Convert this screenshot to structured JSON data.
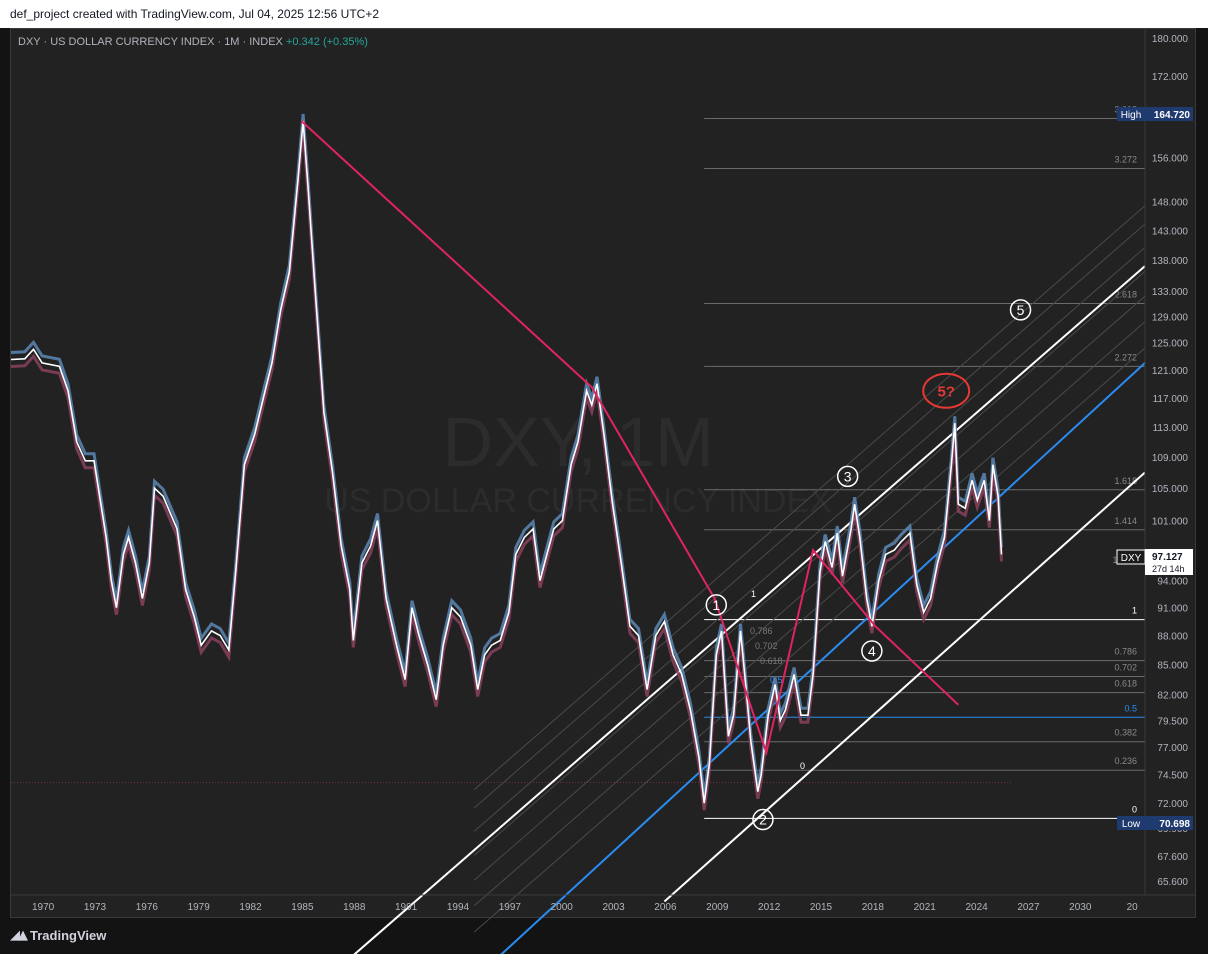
{
  "header": {
    "caption": "def_project created with TradingView.com, Jul 04, 2025 12:56 UTC+2"
  },
  "legend": {
    "symbol_text": "DXY · US DOLLAR CURRENCY INDEX · 1M · INDEX",
    "change_text": "+0.342 (+0.35%)"
  },
  "watermark": {
    "line1": "DXY, 1M",
    "line2": "US DOLLAR CURRENCY INDEX"
  },
  "footer": {
    "brand": "TradingView",
    "logo_icon": "tradingview-logo-icon"
  },
  "colors": {
    "background": "#222222",
    "price_line": "#ffffff",
    "upper_band": "#5b87b5",
    "lower_band": "#8a3f5e",
    "trendline": "#e0245e",
    "channel": "#ffffff",
    "midline": "#2a8cf0",
    "wave5_marker": "#e53935",
    "change_text": "#26a69a"
  },
  "chart_data": {
    "type": "line",
    "title": "DXY · US DOLLAR CURRENCY INDEX · 1M · INDEX",
    "scale": "log",
    "ylim": [
      64.5,
      182
    ],
    "xlim": [
      1968.2,
      2033.8
    ],
    "x_ticks": [
      "1970",
      "1973",
      "1976",
      "1979",
      "1982",
      "1985",
      "1988",
      "1991",
      "1994",
      "1997",
      "2000",
      "2003",
      "2006",
      "2009",
      "2012",
      "2015",
      "2018",
      "2021",
      "2024",
      "2027",
      "2030",
      "20"
    ],
    "y_ticks": [
      "180.000",
      "172.000",
      "156.000",
      "148.000",
      "143.000",
      "138.000",
      "133.000",
      "129.000",
      "125.000",
      "121.000",
      "117.000",
      "113.000",
      "109.000",
      "105.000",
      "101.000",
      "94.000",
      "91.000",
      "88.000",
      "85.000",
      "82.000",
      "79.500",
      "77.000",
      "74.500",
      "72.000",
      "69.900",
      "67.600",
      "65.600"
    ],
    "series": [
      {
        "values": [
          [
            1968.2,
            122.5
          ],
          [
            1969.0,
            122.6
          ],
          [
            1969.5,
            124.0
          ],
          [
            1970.0,
            122.0
          ],
          [
            1971.0,
            121.5
          ],
          [
            1971.5,
            118.0
          ],
          [
            1972.0,
            111.0
          ],
          [
            1972.5,
            108.5
          ],
          [
            1973.0,
            108.5
          ],
          [
            1973.4,
            103.0
          ],
          [
            1973.7,
            99.0
          ],
          [
            1974.0,
            94.0
          ],
          [
            1974.3,
            91.0
          ],
          [
            1974.7,
            97.0
          ],
          [
            1975.0,
            99.0
          ],
          [
            1975.4,
            96.0
          ],
          [
            1975.8,
            92.0
          ],
          [
            1976.2,
            96.0
          ],
          [
            1976.5,
            105.0
          ],
          [
            1977.0,
            104.0
          ],
          [
            1977.8,
            100.0
          ],
          [
            1978.3,
            93.0
          ],
          [
            1978.8,
            90.0
          ],
          [
            1979.2,
            87.0
          ],
          [
            1979.8,
            88.5
          ],
          [
            1980.3,
            88.0
          ],
          [
            1980.8,
            86.5
          ],
          [
            1981.2,
            95.0
          ],
          [
            1981.7,
            108.0
          ],
          [
            1982.3,
            112.0
          ],
          [
            1982.8,
            117.0
          ],
          [
            1983.3,
            122.0
          ],
          [
            1983.8,
            130.0
          ],
          [
            1984.3,
            136.0
          ],
          [
            1984.8,
            152.0
          ],
          [
            1985.1,
            163.0
          ],
          [
            1985.4,
            150.0
          ],
          [
            1985.8,
            133.0
          ],
          [
            1986.3,
            115.0
          ],
          [
            1986.8,
            107.0
          ],
          [
            1987.3,
            98.0
          ],
          [
            1987.8,
            93.0
          ],
          [
            1988.0,
            87.5
          ],
          [
            1988.5,
            96.0
          ],
          [
            1989.0,
            98.0
          ],
          [
            1989.4,
            101.0
          ],
          [
            1989.9,
            92.0
          ],
          [
            1990.5,
            87.0
          ],
          [
            1991.0,
            83.5
          ],
          [
            1991.4,
            91.0
          ],
          [
            1991.8,
            88.0
          ],
          [
            1992.3,
            85.0
          ],
          [
            1992.8,
            81.5
          ],
          [
            1993.2,
            87.0
          ],
          [
            1993.7,
            91.0
          ],
          [
            1994.2,
            90.0
          ],
          [
            1994.8,
            87.0
          ],
          [
            1995.2,
            82.5
          ],
          [
            1995.6,
            86.0
          ],
          [
            1996.0,
            87.0
          ],
          [
            1996.5,
            87.5
          ],
          [
            1997.0,
            90.5
          ],
          [
            1997.4,
            97.0
          ],
          [
            1997.9,
            99.0
          ],
          [
            1998.4,
            100.0
          ],
          [
            1998.8,
            94.0
          ],
          [
            1999.2,
            97.0
          ],
          [
            1999.6,
            100.0
          ],
          [
            2000.1,
            101.0
          ],
          [
            2000.6,
            108.0
          ],
          [
            2001.0,
            111.0
          ],
          [
            2001.5,
            118.0
          ],
          [
            2001.8,
            116.0
          ],
          [
            2002.1,
            119.0
          ],
          [
            2002.5,
            112.0
          ],
          [
            2003.0,
            103.0
          ],
          [
            2003.5,
            96.0
          ],
          [
            2004.0,
            89.0
          ],
          [
            2004.5,
            88.0
          ],
          [
            2005.0,
            82.5
          ],
          [
            2005.5,
            88.0
          ],
          [
            2006.0,
            89.5
          ],
          [
            2006.5,
            86.0
          ],
          [
            2007.0,
            84.0
          ],
          [
            2007.5,
            80.5
          ],
          [
            2008.0,
            76.0
          ],
          [
            2008.3,
            72.0
          ],
          [
            2008.6,
            75.5
          ],
          [
            2009.0,
            86.0
          ],
          [
            2009.3,
            88.5
          ],
          [
            2009.7,
            78.0
          ],
          [
            2010.0,
            80.0
          ],
          [
            2010.4,
            88.5
          ],
          [
            2010.7,
            83.0
          ],
          [
            2011.0,
            77.5
          ],
          [
            2011.4,
            73.0
          ],
          [
            2011.6,
            74.5
          ],
          [
            2012.0,
            80.0
          ],
          [
            2012.4,
            83.0
          ],
          [
            2012.7,
            79.5
          ],
          [
            2013.0,
            80.5
          ],
          [
            2013.5,
            84.0
          ],
          [
            2013.9,
            80.0
          ],
          [
            2014.3,
            80.0
          ],
          [
            2014.6,
            84.0
          ],
          [
            2015.0,
            95.0
          ],
          [
            2015.3,
            98.5
          ],
          [
            2015.7,
            95.5
          ],
          [
            2016.0,
            99.5
          ],
          [
            2016.3,
            94.5
          ],
          [
            2016.8,
            100.0
          ],
          [
            2017.0,
            103.0
          ],
          [
            2017.3,
            99.0
          ],
          [
            2017.7,
            92.0
          ],
          [
            2018.0,
            89.0
          ],
          [
            2018.4,
            94.0
          ],
          [
            2018.8,
            97.0
          ],
          [
            2019.3,
            97.5
          ],
          [
            2019.7,
            98.5
          ],
          [
            2020.2,
            99.5
          ],
          [
            2020.6,
            93.5
          ],
          [
            2021.0,
            90.5
          ],
          [
            2021.4,
            92.0
          ],
          [
            2021.8,
            96.0
          ],
          [
            2022.2,
            99.0
          ],
          [
            2022.6,
            108.0
          ],
          [
            2022.8,
            113.5
          ],
          [
            2023.0,
            103.0
          ],
          [
            2023.4,
            102.5
          ],
          [
            2023.8,
            106.0
          ],
          [
            2024.1,
            103.5
          ],
          [
            2024.5,
            106.0
          ],
          [
            2024.8,
            101.0
          ],
          [
            2025.0,
            108.0
          ],
          [
            2025.3,
            104.0
          ],
          [
            2025.5,
            97.0
          ]
        ]
      }
    ],
    "high_label": "High",
    "high_value": "164.720",
    "low_label": "Low",
    "low_value": "70.698",
    "last_symbol": "DXY",
    "last_value": "97.127",
    "countdown": "27d 14h",
    "trendline": {
      "points": [
        [
          1985.0,
          163.0
        ],
        [
          2001.8,
          118.5
        ],
        [
          2008.9,
          92.0
        ],
        [
          2011.9,
          76.5
        ],
        [
          2014.6,
          97.5
        ],
        [
          2018.2,
          89.0
        ],
        [
          2023.0,
          81.0
        ]
      ]
    },
    "channel": {
      "upper": [
        [
          1988.0,
          60.0
        ],
        [
          2033.8,
          137.0
        ]
      ],
      "mid": [
        [
          1996.5,
          60.0
        ],
        [
          2033.8,
          122.0
        ]
      ],
      "lower": [
        [
          2006.0,
          64.0
        ],
        [
          2033.8,
          107.0
        ]
      ],
      "parallel_prices_at_2008": [
        92.5,
        90.5,
        88.0,
        85.5,
        83.0,
        80.5,
        78.0
      ],
      "upper_label": "1",
      "lower_label": "0",
      "mid_label": "0.5",
      "inner_labels": [
        "0.786",
        "0.702",
        "0.618"
      ]
    },
    "fib_levels": [
      {
        "label": "3.618",
        "value": 163.5
      },
      {
        "label": "3.272",
        "value": 154.0
      },
      {
        "label": "2.618",
        "value": 131.0
      },
      {
        "label": "2.272",
        "value": 121.5
      },
      {
        "label": "1.618",
        "value": 104.8
      },
      {
        "label": "1.414",
        "value": 99.9
      },
      {
        "label": "1",
        "value": 89.7
      },
      {
        "label": "0.786",
        "value": 85.4
      },
      {
        "label": "0.702",
        "value": 83.8
      },
      {
        "label": "0.618",
        "value": 82.2
      },
      {
        "label": "0.5",
        "value": 79.8
      },
      {
        "label": "0.382",
        "value": 77.5
      },
      {
        "label": "0.236",
        "value": 74.9
      },
      {
        "label": "0",
        "value": 70.7
      }
    ],
    "fib_x_start": 2008.3,
    "extra_fib_label": "1",
    "waves": [
      {
        "label": "1",
        "x": 2009.0,
        "y": 91.3
      },
      {
        "label": "2",
        "x": 2011.7,
        "y": 70.6
      },
      {
        "label": "3",
        "x": 2016.6,
        "y": 106.5
      },
      {
        "label": "4",
        "x": 2018.0,
        "y": 86.4
      },
      {
        "label": "5",
        "x": 2026.6,
        "y": 130.0
      }
    ],
    "wave5_question": {
      "label": "5?",
      "x": 2022.3,
      "y": 118.0
    },
    "dotted_reference_value": 73.8
  }
}
